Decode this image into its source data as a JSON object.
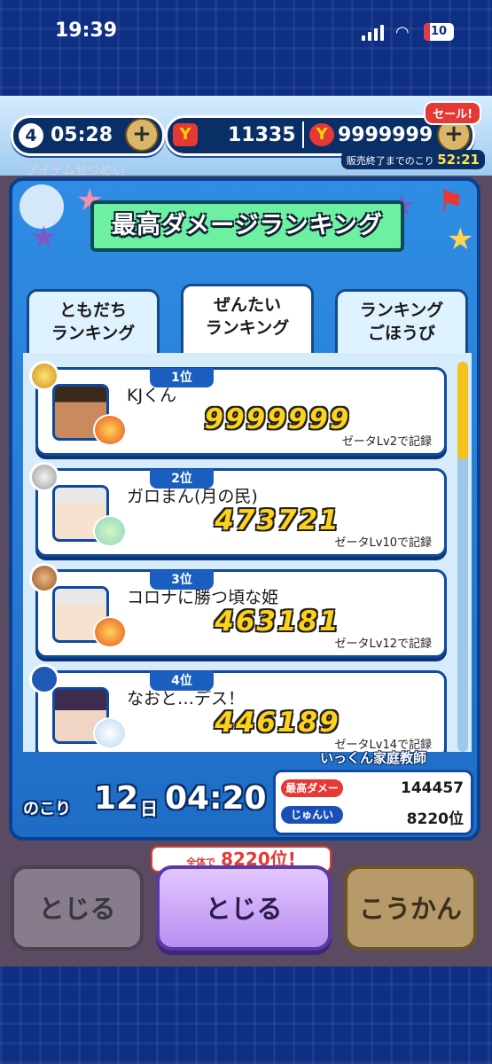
{
  "status_bar": {
    "time": "19:39",
    "battery": "10"
  },
  "top_bar": {
    "level": "4",
    "stamina_timer": "05:28",
    "currency_points": "11335",
    "currency_money": "9999999",
    "sale_label": "セール!",
    "sale_timer_label": "販売終了までのこり",
    "sale_timer": "52:21"
  },
  "background_text": "アイテムせつめい",
  "banner_title": "最高ダメージランキング",
  "tabs": [
    {
      "label": "ともだち\nランキング"
    },
    {
      "label": "ぜんたい\nランキング"
    },
    {
      "label": "ランキング\nごほうび"
    }
  ],
  "entries": [
    {
      "rank": "1位",
      "name": "KJくん",
      "score": "9999999",
      "record": "ゼータLv2で記録"
    },
    {
      "rank": "2位",
      "name": "ガロまん(月の民)",
      "score": "473721",
      "record": "ゼータLv10で記録"
    },
    {
      "rank": "3位",
      "name": "コロナに勝つ頃な姫",
      "score": "463181",
      "record": "ゼータLv12で記録"
    },
    {
      "rank": "4位",
      "name": "なおと…デス！",
      "score": "446189",
      "record": "ゼータLv14で記録"
    }
  ],
  "remaining": {
    "label": "のこり",
    "days": "12",
    "day_unit": "日",
    "clock": "04:20"
  },
  "my_status": {
    "name": "いっくん家庭教師",
    "max_damage_label": "最高ダメージ",
    "max_damage": "144457",
    "rank_label": "じゅんい",
    "rank": "8220位"
  },
  "behind_strip": {
    "prefix": "全体で",
    "value": "8220位!"
  },
  "buttons": {
    "close_left": "とじる",
    "close_main": "とじる",
    "exchange": "こうかん"
  },
  "scroll_fraction": 0.25
}
